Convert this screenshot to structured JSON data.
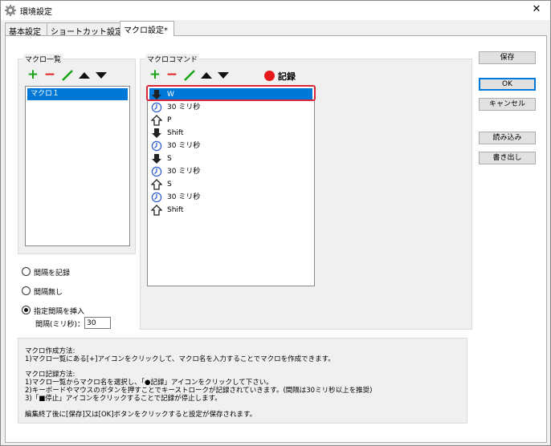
{
  "window": {
    "title": "環境設定",
    "close": "✕"
  },
  "tabs": [
    {
      "label": "基本設定"
    },
    {
      "label": "ショートカット設定"
    },
    {
      "label": "マクロ設定*"
    }
  ],
  "macro_list": {
    "group_label": "マクロ一覧",
    "items": [
      {
        "label": "マクロ１",
        "selected": true
      }
    ]
  },
  "macro_commands": {
    "group_label": "マクロコマンド",
    "record_label": "記録",
    "items": [
      {
        "icon": "key-down-icon",
        "text": "W",
        "selected": true
      },
      {
        "icon": "clock-icon",
        "text": "30 ミリ秒"
      },
      {
        "icon": "key-up-icon",
        "text": "P"
      },
      {
        "icon": "key-down-icon",
        "text": "Shift"
      },
      {
        "icon": "clock-icon",
        "text": "30 ミリ秒"
      },
      {
        "icon": "key-down-icon",
        "text": "S"
      },
      {
        "icon": "clock-icon",
        "text": "30 ミリ秒"
      },
      {
        "icon": "key-up-icon",
        "text": "S"
      },
      {
        "icon": "clock-icon",
        "text": "30 ミリ秒"
      },
      {
        "icon": "key-up-icon",
        "text": "Shift"
      }
    ]
  },
  "interval_options": {
    "record": "間隔を記録",
    "none": "間隔無し",
    "specified": "指定間隔を挿入",
    "selected": "specified",
    "interval_label": "間隔(ミリ秒)：",
    "interval_value": "30"
  },
  "help": {
    "lines": [
      "マクロ作成方法:",
      "1)マクロ一覧にある[+]アイコンをクリックして、マクロ名を入力することでマクロを作成できます。",
      "",
      "マクロ記録方法:",
      "1)マクロ一覧からマクロ名を選択し、「●記録」アイコンをクリックして下さい。",
      "2)キーボードやマウスのボタンを押すことでキーストロークが記録されていきます。(間隔は30ミリ秒以上を推奨)",
      "3)「■停止」アイコンをクリックすることで記録が停止します。",
      "",
      "編集終了後に[保存]又は[OK]ボタンをクリックすると設定が保存されます。"
    ]
  },
  "buttons": {
    "save": "保存",
    "ok": "OK",
    "cancel": "キャンセル",
    "import": "読み込み",
    "export": "書き出し"
  },
  "colors": {
    "add": "#1aa31a",
    "remove": "#e61a1a",
    "edit": "#1aa31a",
    "selection": "#0078d7",
    "highlight": "#d9263a"
  }
}
